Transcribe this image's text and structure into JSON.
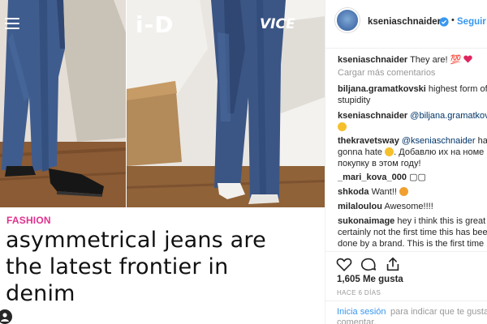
{
  "post_image": {
    "brand_logo": "i-D",
    "partner_logo": "VICE",
    "category": "FASHION",
    "headline_lines": [
      "asymmetrical jeans are",
      "the latest frontier in",
      "denim"
    ],
    "menu_icon": "hamburger-menu-icon"
  },
  "instagram": {
    "header": {
      "username": "kseniaschnaider",
      "verified_icon": "verified-badge-icon",
      "separator": "•",
      "follow_label": "Seguir"
    },
    "caption": {
      "username": "kseniaschnaider",
      "text": "They are! 💯"
    },
    "load_more": "Cargar más comentarios",
    "comments": [
      {
        "user": "biljana.gramatkovski",
        "text": "highest form of",
        "cont": "stupidity"
      },
      {
        "user": "kseniaschnaider",
        "mention": "@biljana.gramatkovski",
        "text": "",
        "cont": ""
      },
      {
        "user": "thekravetsway",
        "mention": "@kseniaschnaider",
        "text": "hate",
        "cont": "gonna hate",
        "cont2": "Добавлю их на номе",
        "cont3": "покупку в этом году!"
      },
      {
        "user": "_mari_kova_000",
        "text": "▢▢"
      },
      {
        "user": "shkoda",
        "text": "Want!!"
      },
      {
        "user": "milaloulou",
        "text": "Awesome!!!!"
      },
      {
        "user": "sukonaimage",
        "text": "hey i think this is great b",
        "cont": "certainly not the first time this has bee",
        "cont2": "done by a brand. This is the first time I"
      }
    ],
    "actions": {
      "like_icon": "heart-outline-icon",
      "comment_icon": "comment-bubble-icon",
      "share_icon": "share-arrow-icon",
      "likes": "1,605 Me gusta",
      "time_ago": "HACE 6 DÍAS"
    },
    "login_prompt": {
      "link": "Inicia sesión",
      "rest": "para indicar que te gusta",
      "rest2": "comentar."
    }
  },
  "colors": {
    "category": "#e0308e",
    "link_blue": "#3897f0",
    "mention_blue": "#003569",
    "denim": "#3b5685"
  }
}
